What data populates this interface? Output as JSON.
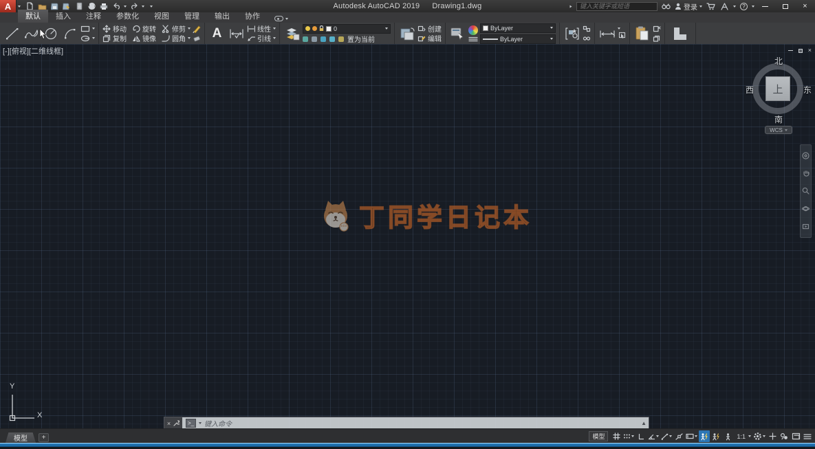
{
  "title_bar": {
    "app_title": "Autodesk AutoCAD 2019",
    "doc_title": "Drawing1.dwg",
    "search_placeholder": "键入关键字或短语",
    "sign_in_label": "登录"
  },
  "ribbon": {
    "tabs": [
      {
        "label": "默认",
        "active": true
      },
      {
        "label": "插入",
        "active": false
      },
      {
        "label": "注释",
        "active": false
      },
      {
        "label": "参数化",
        "active": false
      },
      {
        "label": "视图",
        "active": false
      },
      {
        "label": "管理",
        "active": false
      },
      {
        "label": "输出",
        "active": false
      },
      {
        "label": "协作",
        "active": false
      }
    ],
    "modify": {
      "move": "移动",
      "rotate": "旋转",
      "trim": "修剪",
      "copy": "复制",
      "mirror": "镜像",
      "fillet": "圆角"
    },
    "annotation": {
      "linear": "线性",
      "leader": "引线"
    },
    "layers": {
      "current_layer": "0",
      "set_current": "置为当前"
    },
    "block": {
      "create": "创建",
      "edit": "编辑"
    },
    "properties": {
      "color": "ByLayer",
      "lineweight": "ByLayer"
    }
  },
  "canvas": {
    "viewport_controls": "[-][俯视][二维线框]",
    "viewcube": {
      "north": "北",
      "south": "南",
      "west": "西",
      "east": "东",
      "top": "上",
      "wcs": "WCS"
    },
    "watermark": "丁同学日记本",
    "ucs": {
      "x": "X",
      "y": "Y"
    }
  },
  "command_line": {
    "prompt_placeholder": "键入命令"
  },
  "status_bar": {
    "model_tab": "模型",
    "add_layout_label": "+",
    "model_toggle": "模型",
    "annotation_scale": "1:1"
  },
  "icons": {
    "close": "×",
    "help": "?",
    "command_prompt": ">_",
    "recent_commands": "▲",
    "logo_letter": "A"
  },
  "colors": {
    "logo_red": "#c23b2a",
    "active_toggle_blue": "#2d76b4",
    "watermark_orange": "#ba6228",
    "taskbar_blue": "#2b86c8",
    "canvas_bg": "#171c24"
  }
}
